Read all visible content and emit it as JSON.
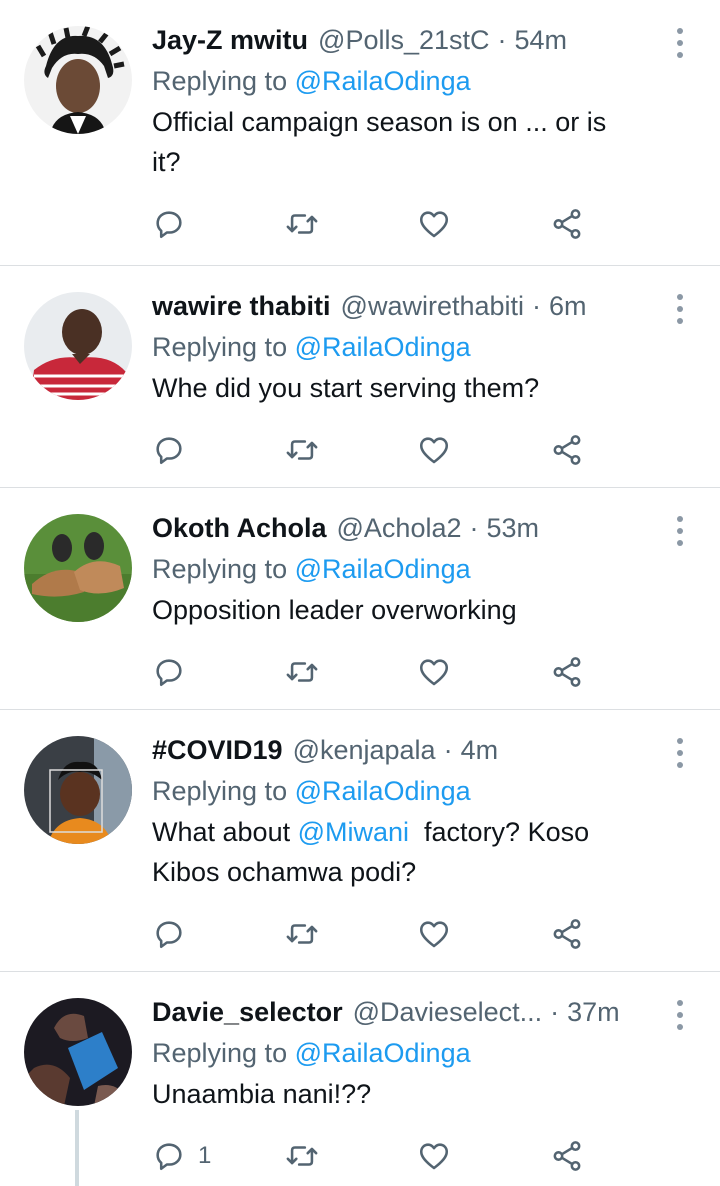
{
  "tweets": [
    {
      "name": "Jay-Z mwitu",
      "handle": "@Polls_21stC",
      "time": "54m",
      "replying_prefix": "Replying to",
      "replying_to": "@RailaOdinga",
      "text_line1": "Official campaign season is on ... or is",
      "text_line2": "it?",
      "reply_count": ""
    },
    {
      "name": "wawire thabiti",
      "handle": "@wawirethabiti",
      "time": "6m",
      "replying_prefix": "Replying to",
      "replying_to": "@RailaOdinga",
      "text_line1": "Whe did you start serving them?",
      "reply_count": ""
    },
    {
      "name": "Okoth Achola",
      "handle": "@Achola2",
      "time": "53m",
      "replying_prefix": "Replying to",
      "replying_to": "@RailaOdinga",
      "text_line1": "Opposition leader overworking",
      "reply_count": ""
    },
    {
      "name": "#COVID19",
      "handle": "@kenjapala",
      "time": "4m",
      "replying_prefix": "Replying to",
      "replying_to": "@RailaOdinga",
      "text_pre": "What about ",
      "text_mention": "@Miwani",
      "text_post": "  factory? Koso",
      "text_line2": "Kibos ochamwa podi?",
      "reply_count": ""
    },
    {
      "name": "Davie_selector",
      "handle": "@Davieselect...",
      "time": "37m",
      "replying_prefix": "Replying to",
      "replying_to": "@RailaOdinga",
      "text_line1": "Unaambia nani!??",
      "reply_count": "1"
    }
  ],
  "separator": "·",
  "icons": {
    "reply": "reply-icon",
    "retweet": "retweet-icon",
    "like": "heart-icon",
    "share": "share-icon",
    "more": "more-vertical-icon"
  },
  "colors": {
    "link": "#1d9bf0",
    "muted": "#536471",
    "icon": "#536471"
  }
}
